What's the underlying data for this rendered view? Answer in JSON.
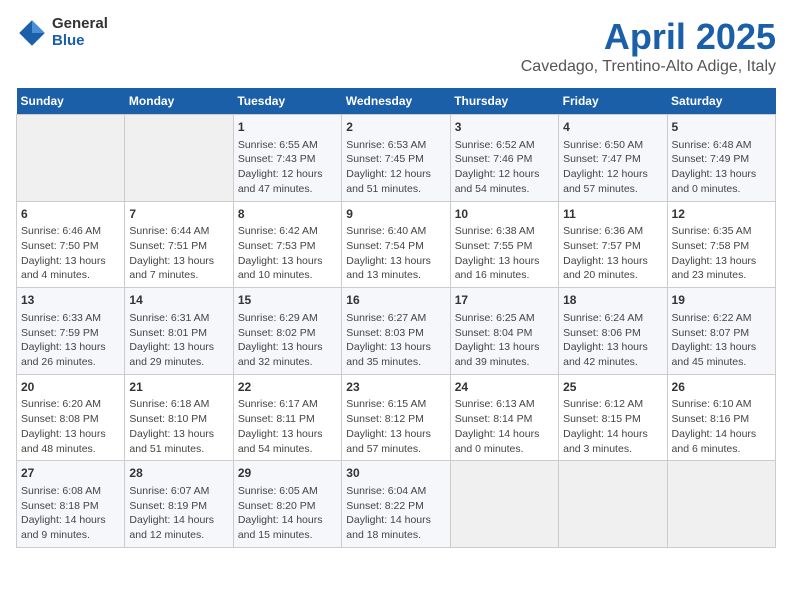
{
  "header": {
    "logo_general": "General",
    "logo_blue": "Blue",
    "title": "April 2025",
    "subtitle": "Cavedago, Trentino-Alto Adige, Italy"
  },
  "days_of_week": [
    "Sunday",
    "Monday",
    "Tuesday",
    "Wednesday",
    "Thursday",
    "Friday",
    "Saturday"
  ],
  "weeks": [
    [
      {
        "day": "",
        "empty": true
      },
      {
        "day": "",
        "empty": true
      },
      {
        "day": "1",
        "sunrise": "Sunrise: 6:55 AM",
        "sunset": "Sunset: 7:43 PM",
        "daylight": "Daylight: 12 hours and 47 minutes."
      },
      {
        "day": "2",
        "sunrise": "Sunrise: 6:53 AM",
        "sunset": "Sunset: 7:45 PM",
        "daylight": "Daylight: 12 hours and 51 minutes."
      },
      {
        "day": "3",
        "sunrise": "Sunrise: 6:52 AM",
        "sunset": "Sunset: 7:46 PM",
        "daylight": "Daylight: 12 hours and 54 minutes."
      },
      {
        "day": "4",
        "sunrise": "Sunrise: 6:50 AM",
        "sunset": "Sunset: 7:47 PM",
        "daylight": "Daylight: 12 hours and 57 minutes."
      },
      {
        "day": "5",
        "sunrise": "Sunrise: 6:48 AM",
        "sunset": "Sunset: 7:49 PM",
        "daylight": "Daylight: 13 hours and 0 minutes."
      }
    ],
    [
      {
        "day": "6",
        "sunrise": "Sunrise: 6:46 AM",
        "sunset": "Sunset: 7:50 PM",
        "daylight": "Daylight: 13 hours and 4 minutes."
      },
      {
        "day": "7",
        "sunrise": "Sunrise: 6:44 AM",
        "sunset": "Sunset: 7:51 PM",
        "daylight": "Daylight: 13 hours and 7 minutes."
      },
      {
        "day": "8",
        "sunrise": "Sunrise: 6:42 AM",
        "sunset": "Sunset: 7:53 PM",
        "daylight": "Daylight: 13 hours and 10 minutes."
      },
      {
        "day": "9",
        "sunrise": "Sunrise: 6:40 AM",
        "sunset": "Sunset: 7:54 PM",
        "daylight": "Daylight: 13 hours and 13 minutes."
      },
      {
        "day": "10",
        "sunrise": "Sunrise: 6:38 AM",
        "sunset": "Sunset: 7:55 PM",
        "daylight": "Daylight: 13 hours and 16 minutes."
      },
      {
        "day": "11",
        "sunrise": "Sunrise: 6:36 AM",
        "sunset": "Sunset: 7:57 PM",
        "daylight": "Daylight: 13 hours and 20 minutes."
      },
      {
        "day": "12",
        "sunrise": "Sunrise: 6:35 AM",
        "sunset": "Sunset: 7:58 PM",
        "daylight": "Daylight: 13 hours and 23 minutes."
      }
    ],
    [
      {
        "day": "13",
        "sunrise": "Sunrise: 6:33 AM",
        "sunset": "Sunset: 7:59 PM",
        "daylight": "Daylight: 13 hours and 26 minutes."
      },
      {
        "day": "14",
        "sunrise": "Sunrise: 6:31 AM",
        "sunset": "Sunset: 8:01 PM",
        "daylight": "Daylight: 13 hours and 29 minutes."
      },
      {
        "day": "15",
        "sunrise": "Sunrise: 6:29 AM",
        "sunset": "Sunset: 8:02 PM",
        "daylight": "Daylight: 13 hours and 32 minutes."
      },
      {
        "day": "16",
        "sunrise": "Sunrise: 6:27 AM",
        "sunset": "Sunset: 8:03 PM",
        "daylight": "Daylight: 13 hours and 35 minutes."
      },
      {
        "day": "17",
        "sunrise": "Sunrise: 6:25 AM",
        "sunset": "Sunset: 8:04 PM",
        "daylight": "Daylight: 13 hours and 39 minutes."
      },
      {
        "day": "18",
        "sunrise": "Sunrise: 6:24 AM",
        "sunset": "Sunset: 8:06 PM",
        "daylight": "Daylight: 13 hours and 42 minutes."
      },
      {
        "day": "19",
        "sunrise": "Sunrise: 6:22 AM",
        "sunset": "Sunset: 8:07 PM",
        "daylight": "Daylight: 13 hours and 45 minutes."
      }
    ],
    [
      {
        "day": "20",
        "sunrise": "Sunrise: 6:20 AM",
        "sunset": "Sunset: 8:08 PM",
        "daylight": "Daylight: 13 hours and 48 minutes."
      },
      {
        "day": "21",
        "sunrise": "Sunrise: 6:18 AM",
        "sunset": "Sunset: 8:10 PM",
        "daylight": "Daylight: 13 hours and 51 minutes."
      },
      {
        "day": "22",
        "sunrise": "Sunrise: 6:17 AM",
        "sunset": "Sunset: 8:11 PM",
        "daylight": "Daylight: 13 hours and 54 minutes."
      },
      {
        "day": "23",
        "sunrise": "Sunrise: 6:15 AM",
        "sunset": "Sunset: 8:12 PM",
        "daylight": "Daylight: 13 hours and 57 minutes."
      },
      {
        "day": "24",
        "sunrise": "Sunrise: 6:13 AM",
        "sunset": "Sunset: 8:14 PM",
        "daylight": "Daylight: 14 hours and 0 minutes."
      },
      {
        "day": "25",
        "sunrise": "Sunrise: 6:12 AM",
        "sunset": "Sunset: 8:15 PM",
        "daylight": "Daylight: 14 hours and 3 minutes."
      },
      {
        "day": "26",
        "sunrise": "Sunrise: 6:10 AM",
        "sunset": "Sunset: 8:16 PM",
        "daylight": "Daylight: 14 hours and 6 minutes."
      }
    ],
    [
      {
        "day": "27",
        "sunrise": "Sunrise: 6:08 AM",
        "sunset": "Sunset: 8:18 PM",
        "daylight": "Daylight: 14 hours and 9 minutes."
      },
      {
        "day": "28",
        "sunrise": "Sunrise: 6:07 AM",
        "sunset": "Sunset: 8:19 PM",
        "daylight": "Daylight: 14 hours and 12 minutes."
      },
      {
        "day": "29",
        "sunrise": "Sunrise: 6:05 AM",
        "sunset": "Sunset: 8:20 PM",
        "daylight": "Daylight: 14 hours and 15 minutes."
      },
      {
        "day": "30",
        "sunrise": "Sunrise: 6:04 AM",
        "sunset": "Sunset: 8:22 PM",
        "daylight": "Daylight: 14 hours and 18 minutes."
      },
      {
        "day": "",
        "empty": true
      },
      {
        "day": "",
        "empty": true
      },
      {
        "day": "",
        "empty": true
      }
    ]
  ]
}
